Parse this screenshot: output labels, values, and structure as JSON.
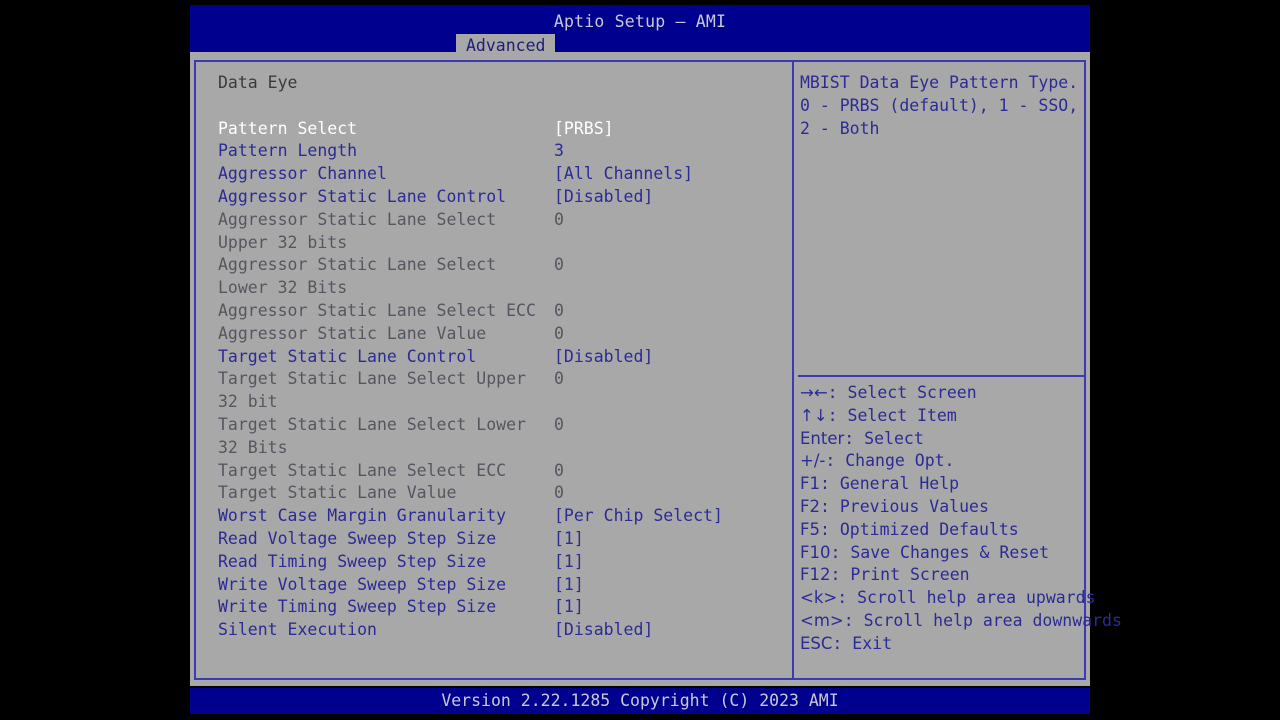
{
  "header": {
    "app_title": "Aptio Setup – AMI",
    "tabs": [
      {
        "label": "Advanced",
        "active": true
      }
    ]
  },
  "main": {
    "section_title": "Data Eye",
    "value_column_x": 336,
    "rows": [
      {
        "label": "Pattern Select",
        "value": "[PRBS]",
        "state": "selected"
      },
      {
        "label": "Pattern Length",
        "value": "3",
        "state": "enabled"
      },
      {
        "label": "Aggressor Channel",
        "value": "[All Channels]",
        "state": "enabled"
      },
      {
        "label": "Aggressor Static Lane Control",
        "value": "[Disabled]",
        "state": "enabled"
      },
      {
        "label": "Aggressor Static Lane Select",
        "value": "0",
        "state": "disabled"
      },
      {
        "label": "Upper 32 bits",
        "value": "",
        "state": "disabled"
      },
      {
        "label": "Aggressor Static Lane Select",
        "value": "0",
        "state": "disabled"
      },
      {
        "label": "Lower 32 Bits",
        "value": "",
        "state": "disabled"
      },
      {
        "label": "Aggressor Static Lane Select ECC",
        "value": "0",
        "state": "disabled"
      },
      {
        "label": "Aggressor Static Lane Value",
        "value": "0",
        "state": "disabled"
      },
      {
        "label": "Target Static Lane Control",
        "value": "[Disabled]",
        "state": "enabled"
      },
      {
        "label": "Target Static Lane Select Upper",
        "value": "0",
        "state": "disabled"
      },
      {
        "label": "32 bit",
        "value": "",
        "state": "disabled"
      },
      {
        "label": "Target Static Lane Select Lower",
        "value": "0",
        "state": "disabled"
      },
      {
        "label": "32 Bits",
        "value": "",
        "state": "disabled"
      },
      {
        "label": "Target Static Lane Select ECC",
        "value": "0",
        "state": "disabled"
      },
      {
        "label": "Target Static Lane Value",
        "value": "0",
        "state": "disabled"
      },
      {
        "label": "Worst Case Margin Granularity",
        "value": "[Per Chip Select]",
        "state": "enabled"
      },
      {
        "label": "Read Voltage Sweep Step Size",
        "value": "[1]",
        "state": "enabled"
      },
      {
        "label": "Read Timing Sweep Step Size",
        "value": "[1]",
        "state": "enabled"
      },
      {
        "label": "Write Voltage Sweep Step Size",
        "value": "[1]",
        "state": "enabled"
      },
      {
        "label": "Write Timing Sweep Step Size",
        "value": "[1]",
        "state": "enabled"
      },
      {
        "label": "Silent Execution",
        "value": "[Disabled]",
        "state": "enabled"
      }
    ]
  },
  "help": {
    "text": "MBIST Data Eye Pattern Type. 0 - PRBS (default), 1 - SSO, 2 - Both",
    "legend": [
      {
        "keys": "→←",
        "sep": ": ",
        "action": "Select Screen"
      },
      {
        "keys": "↑↓",
        "sep": ": ",
        "action": "Select Item"
      },
      {
        "keys": "Enter",
        "sep": ": ",
        "action": "Select"
      },
      {
        "keys": "+/-",
        "sep": ": ",
        "action": "Change Opt."
      },
      {
        "keys": "F1",
        "sep": ": ",
        "action": "General Help"
      },
      {
        "keys": "F2",
        "sep": ": ",
        "action": "Previous Values"
      },
      {
        "keys": "F5",
        "sep": ": ",
        "action": "Optimized Defaults"
      },
      {
        "keys": "F10",
        "sep": ": ",
        "action": "Save Changes & Reset"
      },
      {
        "keys": "F12",
        "sep": ": ",
        "action": "Print Screen"
      },
      {
        "keys": "<k>",
        "sep": ": ",
        "action": "Scroll help area upwards"
      },
      {
        "keys": "<m>",
        "sep": ": ",
        "action": "Scroll help area downwards"
      },
      {
        "keys": "ESC",
        "sep": ": ",
        "action": "Exit"
      }
    ]
  },
  "footer": {
    "version_text": "Version 2.22.1285 Copyright (C) 2023 AMI"
  },
  "colors": {
    "header_blue": "#00008f",
    "panel_gray": "#a8a8a8",
    "border_blue": "#3a3ab4",
    "text_blue": "#2b2b96",
    "text_disabled": "#565660",
    "text_selected": "#ffffff",
    "footer_text": "#c9c9d6"
  }
}
